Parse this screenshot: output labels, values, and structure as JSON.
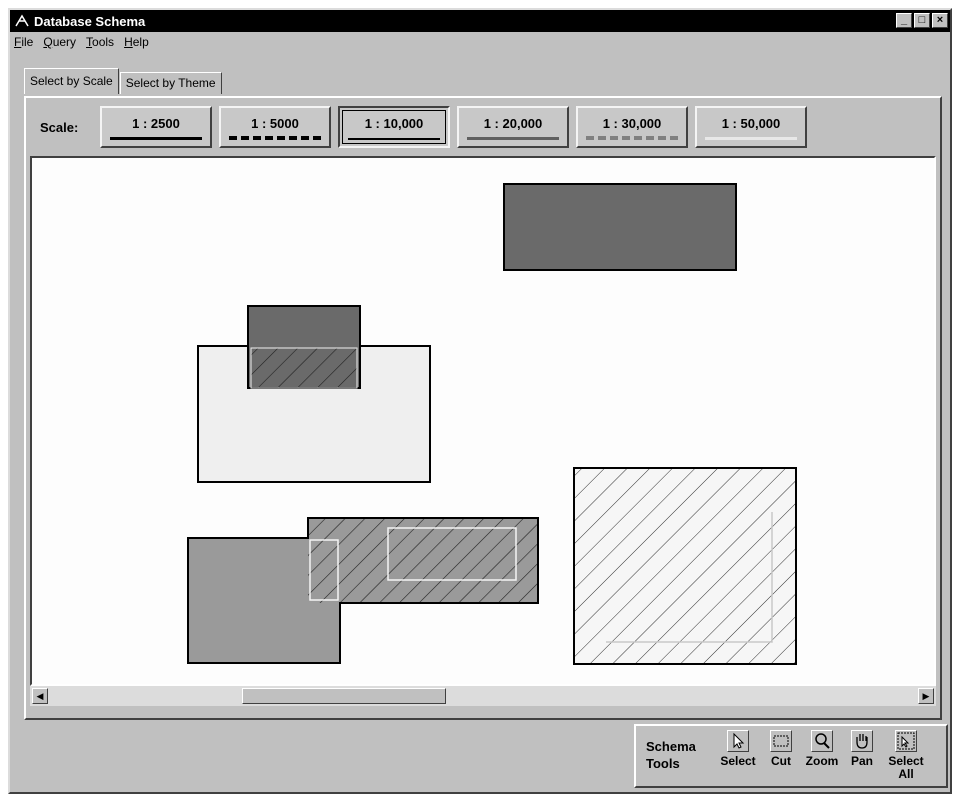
{
  "window": {
    "title": "Database Schema",
    "controls": [
      "_",
      "□",
      "×"
    ]
  },
  "menu": [
    {
      "label": "File",
      "u": "F",
      "rest": "ile"
    },
    {
      "label": "Query",
      "u": "Q",
      "rest": "uery"
    },
    {
      "label": "Tools",
      "u": "T",
      "rest": "ools"
    },
    {
      "label": "Help",
      "u": "H",
      "rest": "elp"
    }
  ],
  "tabs": [
    {
      "label": "Select by Scale",
      "active": true
    },
    {
      "label": "Select by Theme",
      "active": false
    }
  ],
  "scale": {
    "label": "Scale:",
    "buttons": [
      {
        "label": "1 : 2500",
        "line": "solid-thick",
        "active": false
      },
      {
        "label": "1 : 5000",
        "line": "dashed-thick",
        "active": false
      },
      {
        "label": "1 : 10,000",
        "line": "solid",
        "active": true
      },
      {
        "label": "1 : 20,000",
        "line": "solid-gray",
        "active": false
      },
      {
        "label": "1 : 30,000",
        "line": "dashed-gray",
        "active": false
      },
      {
        "label": "1 : 50,000",
        "line": "light",
        "active": false
      }
    ]
  },
  "colors": {
    "dark_fill": "#6a6a6a",
    "mid_fill": "#9a9a9a",
    "light_fill": "#efefef",
    "window_bg": "#c0c0c0"
  },
  "scroll": {
    "left_icon": "left-arrow-icon",
    "right_icon": "right-arrow-icon"
  },
  "toolbox": {
    "title_line1": "Schema",
    "title_line2": "Tools",
    "tools": [
      {
        "label": "Select",
        "icon": "arrow-pointer-icon"
      },
      {
        "label": "Cut",
        "icon": "dashed-rect-icon"
      },
      {
        "label": "Zoom",
        "icon": "magnifier-icon"
      },
      {
        "label": "Pan",
        "icon": "hand-icon"
      },
      {
        "label": "Select All",
        "icon": "select-all-icon"
      }
    ]
  }
}
